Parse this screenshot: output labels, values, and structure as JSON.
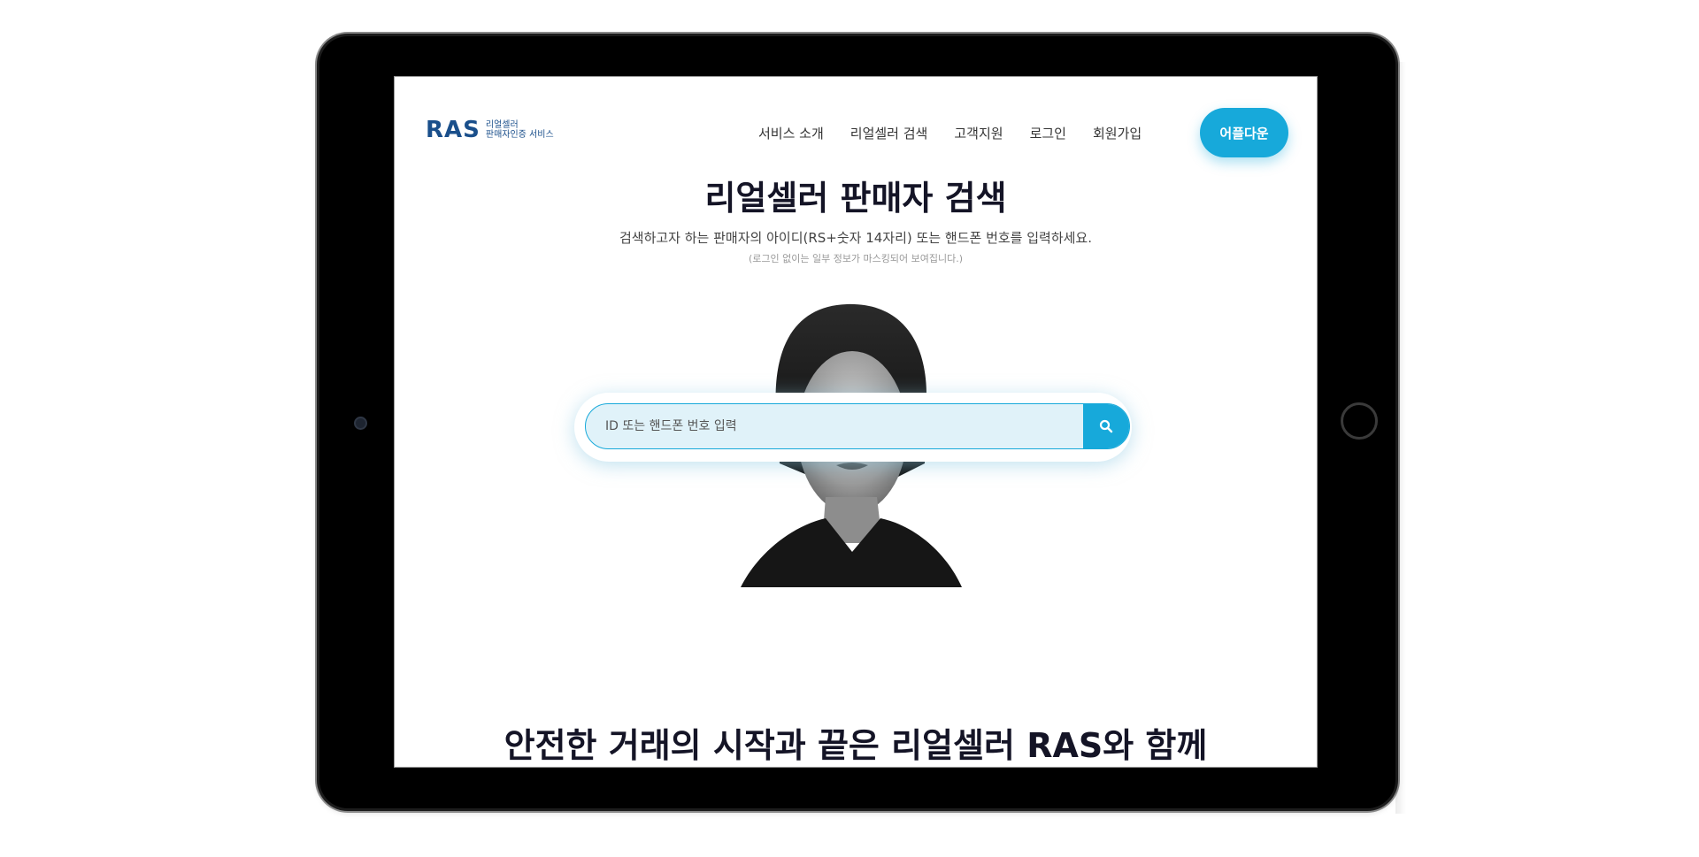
{
  "header": {
    "logo_mark": "RAS",
    "logo_line1": "리얼셀러",
    "logo_line2": "판매자인증 서비스",
    "nav": [
      "서비스 소개",
      "리얼셀러 검색",
      "고객지원",
      "로그인",
      "회원가입"
    ],
    "cta_label": "어플다운"
  },
  "hero": {
    "title": "리얼셀러 판매자 검색",
    "subtitle": "검색하고자 하는 판매자의 아이디(RS+숫자 14자리) 또는 핸드폰 번호를 입력하세요.",
    "note": "(로그인 없이는 일부 정보가 마스킹되어 보여집니다.)"
  },
  "search": {
    "placeholder": "ID 또는 핸드폰 번호 입력",
    "icon": "search-icon"
  },
  "section": {
    "headline": "안전한 거래의 시작과 끝은 리얼셀러 RAS와 함께"
  },
  "colors": {
    "accent": "#17a9da",
    "logo": "#1a4f8b",
    "title": "#141426"
  }
}
